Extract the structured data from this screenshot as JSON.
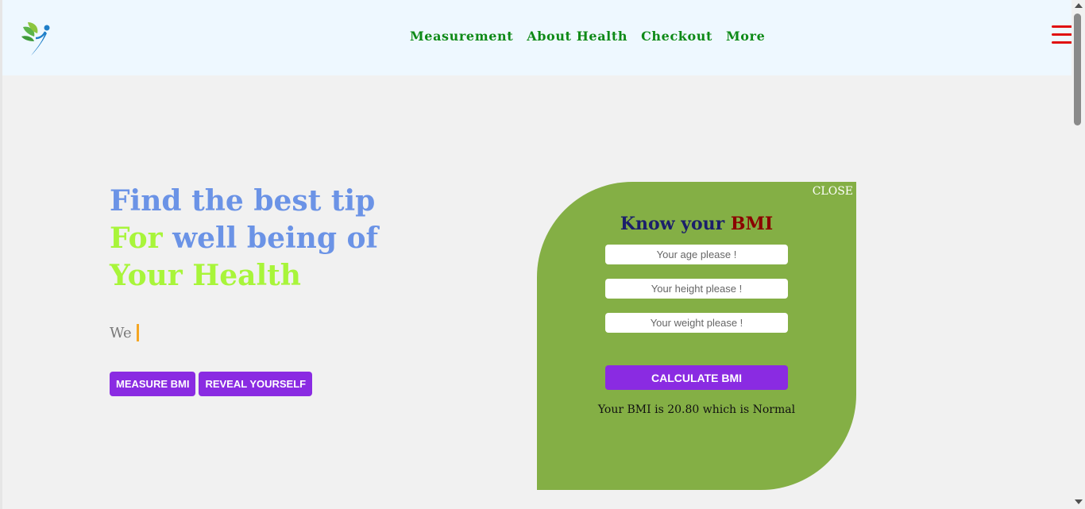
{
  "nav": {
    "logo_icon": "leaf-figure-logo",
    "links": [
      "Measurement",
      "About Health",
      "Checkout",
      "More"
    ],
    "menu_icon": "hamburger-icon",
    "menu_color": "#e01010",
    "link_color": "#0e8a17"
  },
  "hero": {
    "title_part1": "Find the best tip ",
    "title_accent1": "For",
    "title_part2": " well being of ",
    "title_accent2": "Your Health",
    "typed_text": "We",
    "buttons": [
      "MEASURE BMI",
      "REVEAL YOURSELF"
    ],
    "title_color": "#6b93e6",
    "accent_color": "#a8f53a",
    "button_color": "#8a2be2"
  },
  "bmi": {
    "close_label": "CLOSE",
    "title_part1": "Know your ",
    "title_part2": "BMI",
    "age_placeholder": "Your age please !",
    "height_placeholder": "Your height please !",
    "weight_placeholder": "Your weight please !",
    "calculate_label": "CALCULATE BMI",
    "result_text": "Your BMI is 20.80 which is Normal",
    "card_color": "#84af45"
  }
}
